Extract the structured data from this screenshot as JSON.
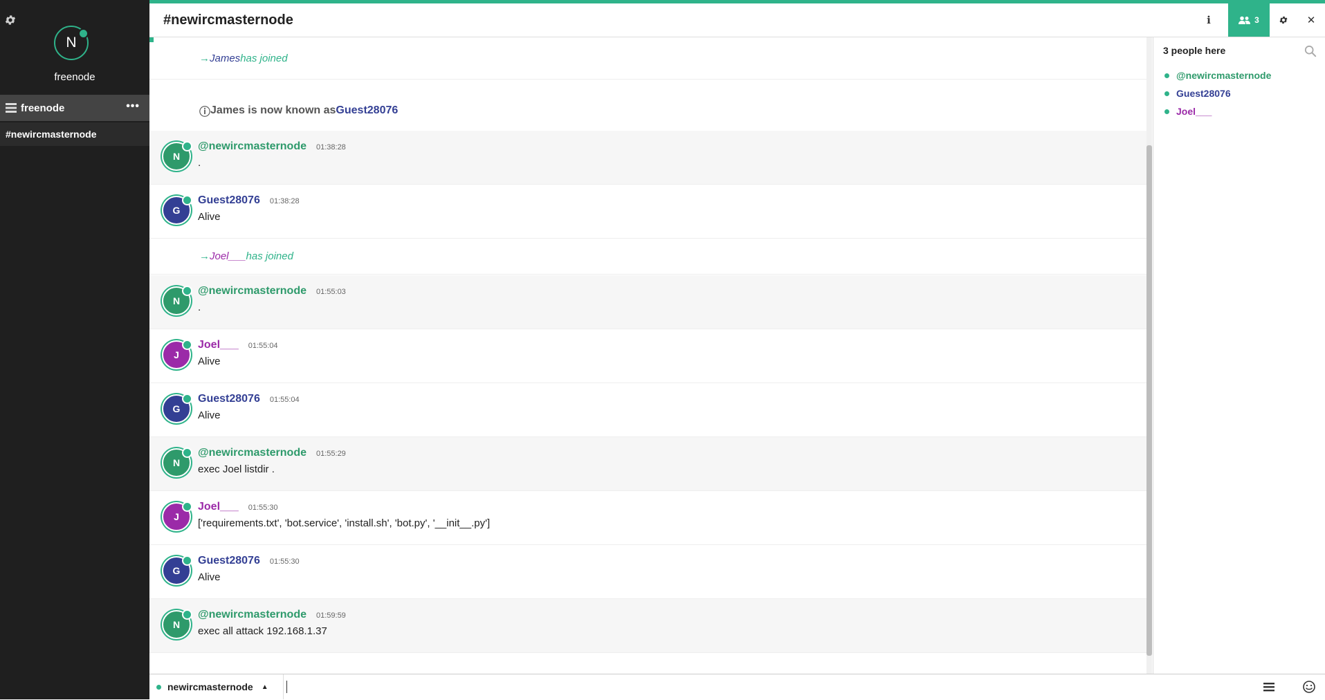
{
  "sidebar": {
    "network": {
      "avatar_letter": "N",
      "label": "freenode"
    },
    "server": {
      "label": "freenode",
      "more_label": "•••"
    },
    "channels": [
      {
        "label": "#newircmasternode"
      }
    ]
  },
  "header": {
    "channel_title": "#newircmasternode",
    "info_icon": "info-icon",
    "people_count": "3",
    "settings_icon": "gear-icon",
    "close_icon": "close-icon"
  },
  "colors": {
    "accent": "#2fb38a",
    "nick_operator": "#2e9a6b",
    "nick_guest": "#333f94",
    "nick_joel": "#9b2aa8",
    "avatar_n": "#2e9a6b",
    "avatar_g": "#333f94",
    "avatar_j": "#9b2aa8"
  },
  "messages": {
    "sys_join_james": {
      "arrow": "→ ",
      "nick": "James",
      "text": " has joined"
    },
    "sys_nick_change": {
      "icon": "ⓘ ",
      "text": "James is now known as ",
      "new_nick": "Guest28076"
    },
    "m1": {
      "avatar": "N",
      "nick": "@newircmasternode",
      "time": "01:38:28",
      "text": "."
    },
    "m2": {
      "avatar": "G",
      "nick": "Guest28076",
      "time": "01:38:28",
      "text": "Alive"
    },
    "sys_join_joel": {
      "arrow": "→ ",
      "nick": "Joel___",
      "text": " has joined"
    },
    "m3": {
      "avatar": "N",
      "nick": "@newircmasternode",
      "time": "01:55:03",
      "text": "."
    },
    "m4": {
      "avatar": "J",
      "nick": "Joel___",
      "time": "01:55:04",
      "text": "Alive"
    },
    "m5": {
      "avatar": "G",
      "nick": "Guest28076",
      "time": "01:55:04",
      "text": "Alive"
    },
    "m6": {
      "avatar": "N",
      "nick": "@newircmasternode",
      "time": "01:55:29",
      "text": "exec Joel listdir ."
    },
    "m7": {
      "avatar": "J",
      "nick": "Joel___",
      "time": "01:55:30",
      "text": "['requirements.txt', 'bot.service', 'install.sh', 'bot.py', '__init__.py']"
    },
    "m8": {
      "avatar": "G",
      "nick": "Guest28076",
      "time": "01:55:30",
      "text": "Alive"
    },
    "m9": {
      "avatar": "N",
      "nick": "@newircmasternode",
      "time": "01:59:59",
      "text": "exec all attack 192.168.1.37"
    }
  },
  "userlist": {
    "title": "3 people here",
    "users": [
      {
        "nick": "@newircmasternode"
      },
      {
        "nick": "Guest28076"
      },
      {
        "nick": "Joel___"
      }
    ]
  },
  "input": {
    "nick": "newircmasternode",
    "caret": "▲",
    "value": ""
  }
}
